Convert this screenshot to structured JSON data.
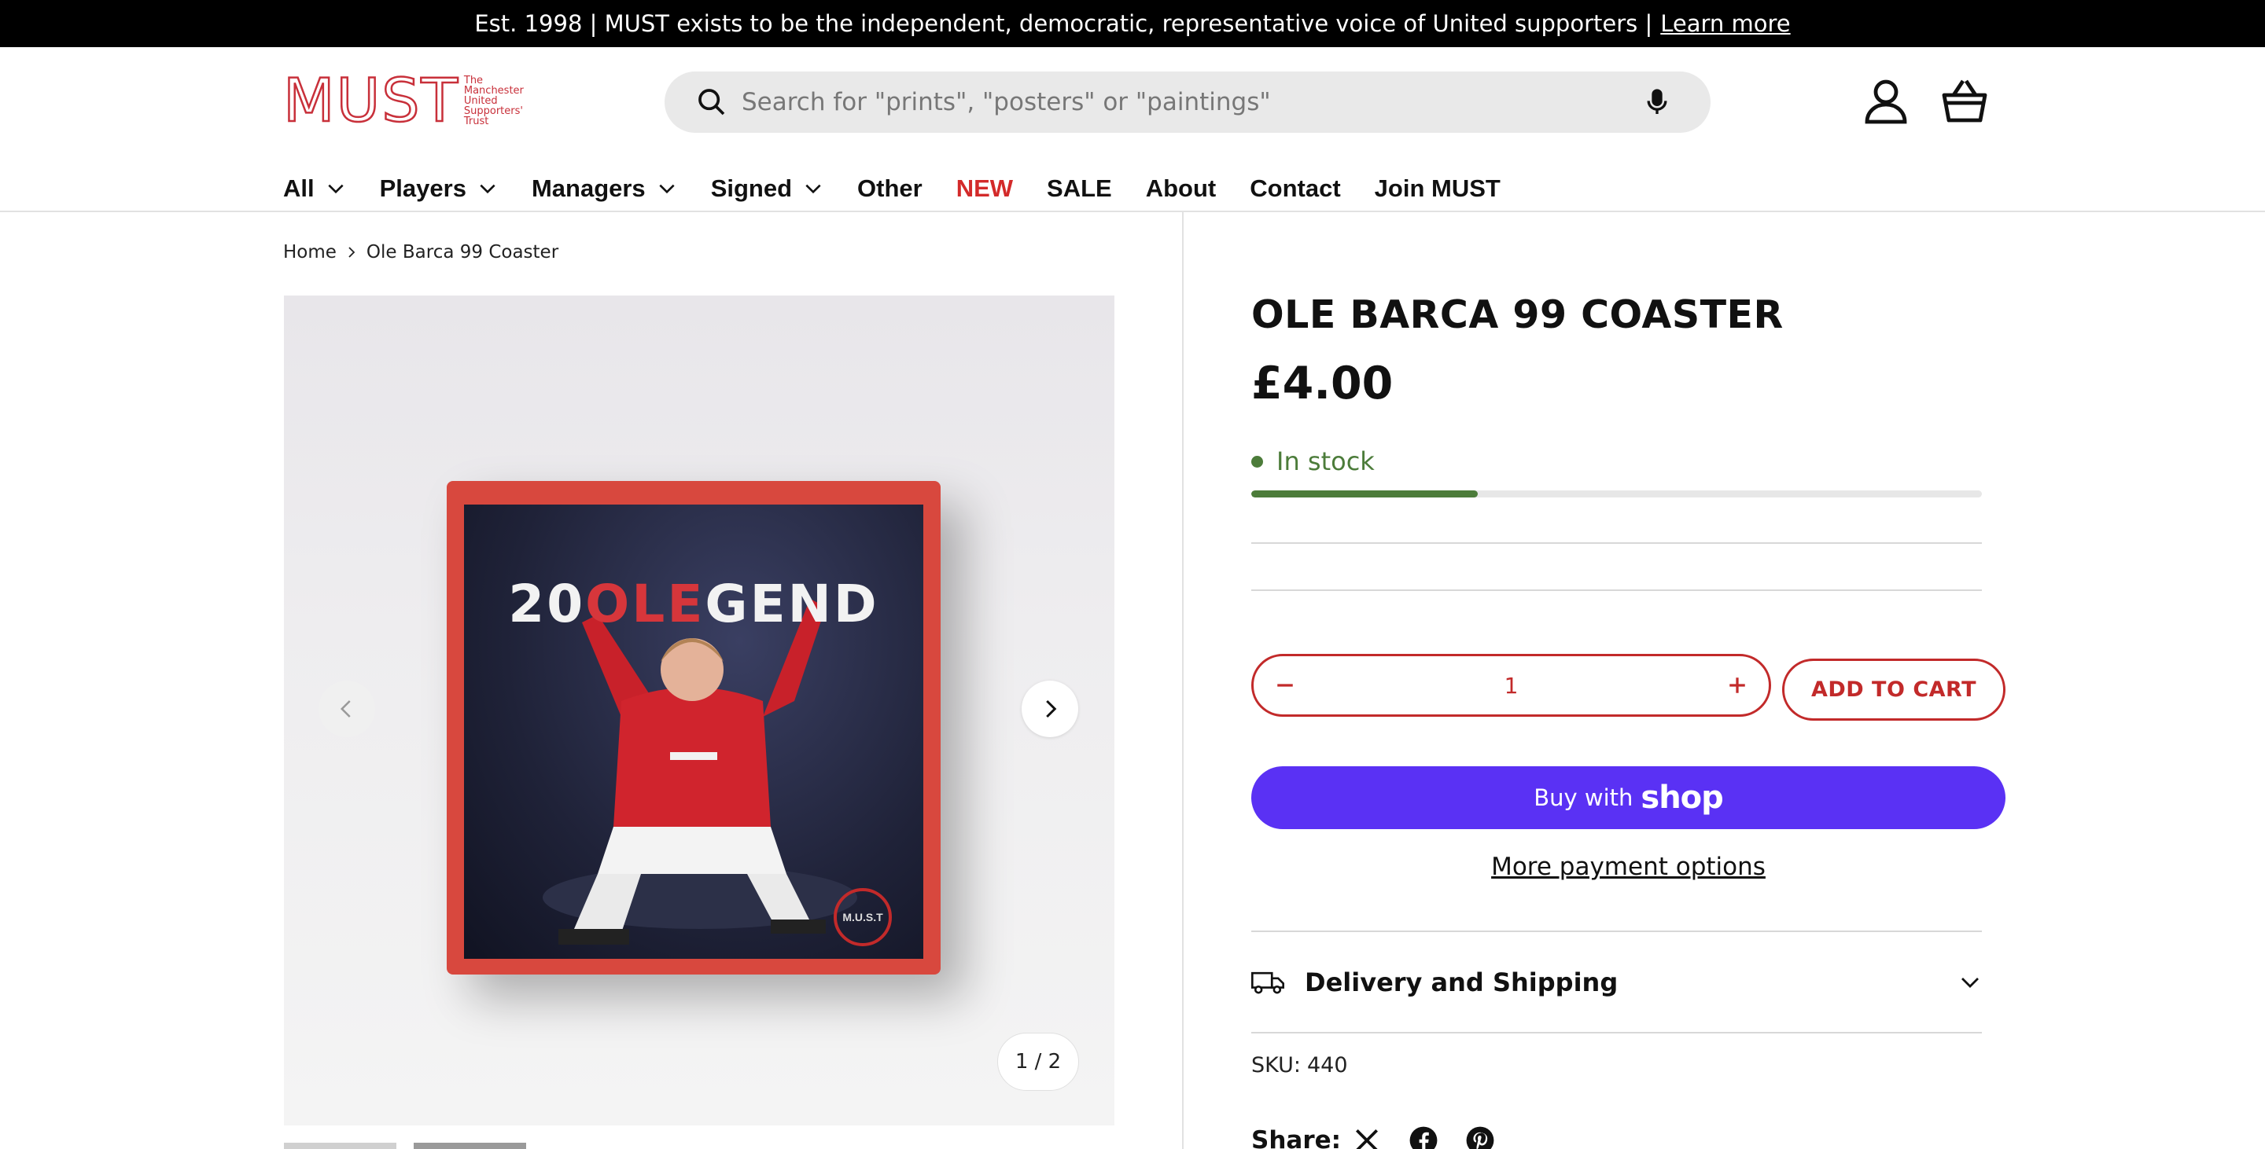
{
  "announcement": {
    "text": "Est. 1998 | MUST exists to be the independent, democratic, representative voice of United supporters |",
    "link": "Learn more"
  },
  "logo": {
    "wordmark": "MUST",
    "sub_lines": [
      "The",
      "Manchester",
      "United",
      "Supporters'",
      "Trust"
    ]
  },
  "search": {
    "placeholder": "Search for \"prints\", \"posters\" or \"paintings\""
  },
  "header_icons": [
    "user-icon",
    "basket-icon"
  ],
  "nav": {
    "items": [
      {
        "label": "All",
        "dropdown": true
      },
      {
        "label": "Players",
        "dropdown": true
      },
      {
        "label": "Managers",
        "dropdown": true
      },
      {
        "label": "Signed",
        "dropdown": true
      },
      {
        "label": "Other",
        "dropdown": false
      },
      {
        "label": "NEW",
        "dropdown": false,
        "color": "#d32a2a"
      },
      {
        "label": "SALE",
        "dropdown": false
      },
      {
        "label": "About",
        "dropdown": false
      },
      {
        "label": "Contact",
        "dropdown": false
      },
      {
        "label": "Join MUST",
        "dropdown": false
      }
    ]
  },
  "breadcrumb": {
    "home": "Home",
    "current": "Ole Barca 99 Coaster"
  },
  "gallery": {
    "image_text_1": "20",
    "image_text_red": "OLE",
    "image_text_2": "GEND",
    "badge": "M.U.S.T",
    "counter": "1 / 2"
  },
  "product": {
    "title": "OLE BARCA 99 COASTER",
    "price": "£4.00",
    "stock_status": "In stock",
    "stock_level_fraction": 0.31,
    "quantity": "1",
    "add_to_cart": "ADD TO CART",
    "buy_with": "Buy with",
    "shop_brand": "shop",
    "more_payment": "More payment options",
    "delivery_label": "Delivery and Shipping",
    "sku_label": "SKU:",
    "sku_value": "440",
    "share_label": "Share:"
  },
  "colors": {
    "accent": "#c22a2a",
    "stock_green": "#4c7c3a",
    "shop_pay": "#5a31f4"
  }
}
